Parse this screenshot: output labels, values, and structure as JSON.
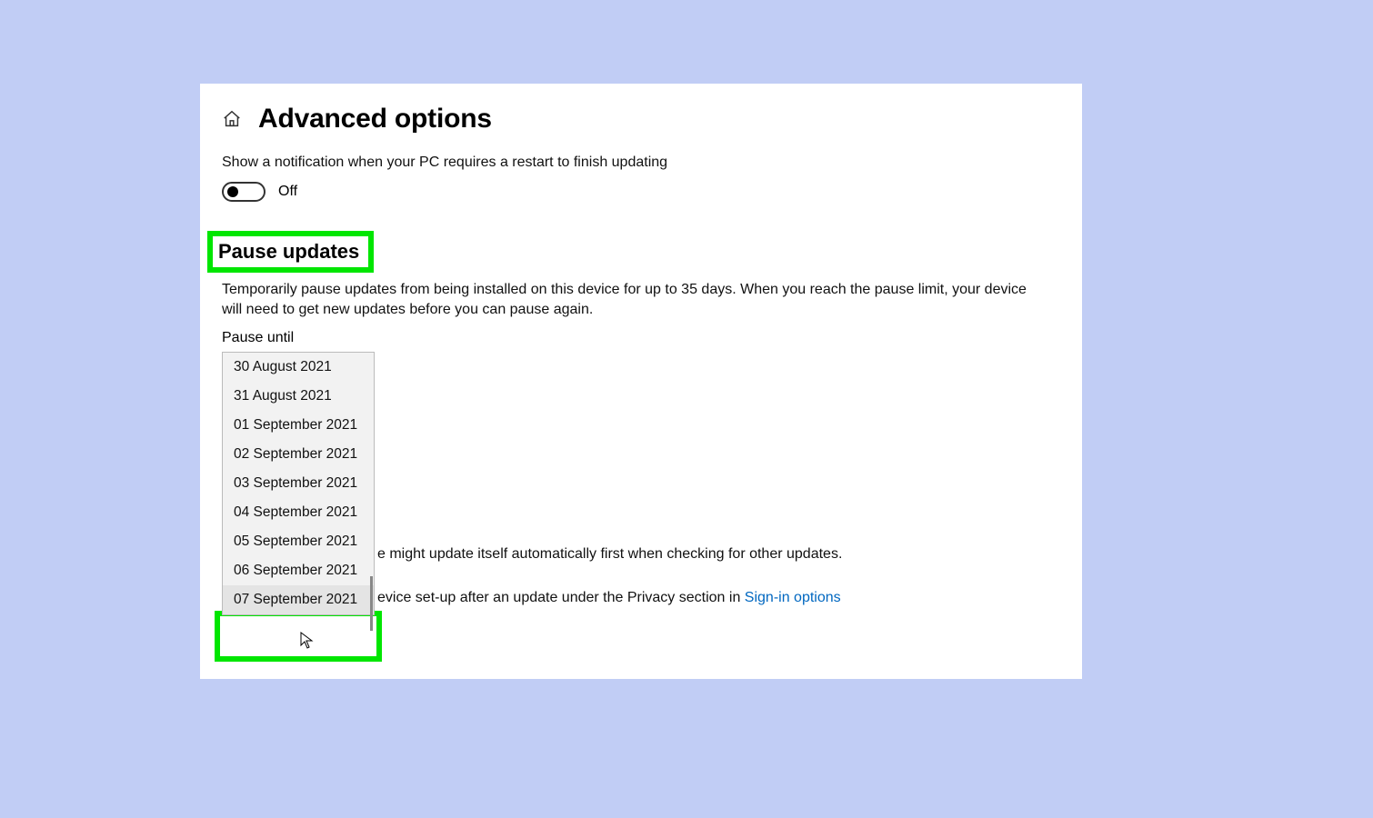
{
  "page_title": "Advanced options",
  "notification": {
    "label": "Show a notification when your PC requires a restart to finish updating",
    "state": "Off"
  },
  "pause": {
    "heading": "Pause updates",
    "description": "Temporarily pause updates from being installed on this device for up to 35 days. When you reach the pause limit, your device will need to get new updates before you can pause again.",
    "until_label": "Pause until",
    "options": [
      "30 August 2021",
      "31 August 2021",
      "01 September 2021",
      "02 September 2021",
      "03 September 2021",
      "04 September 2021",
      "05 September 2021",
      "06 September 2021",
      "07 September 2021"
    ]
  },
  "behind_text": {
    "line1_fragment": "e might update itself automatically first when checking for other updates.",
    "line2_fragment": "evice set-up after an update under the Privacy section in ",
    "link": "Sign-in options"
  },
  "highlight_colors": {
    "box": "#00e600"
  }
}
